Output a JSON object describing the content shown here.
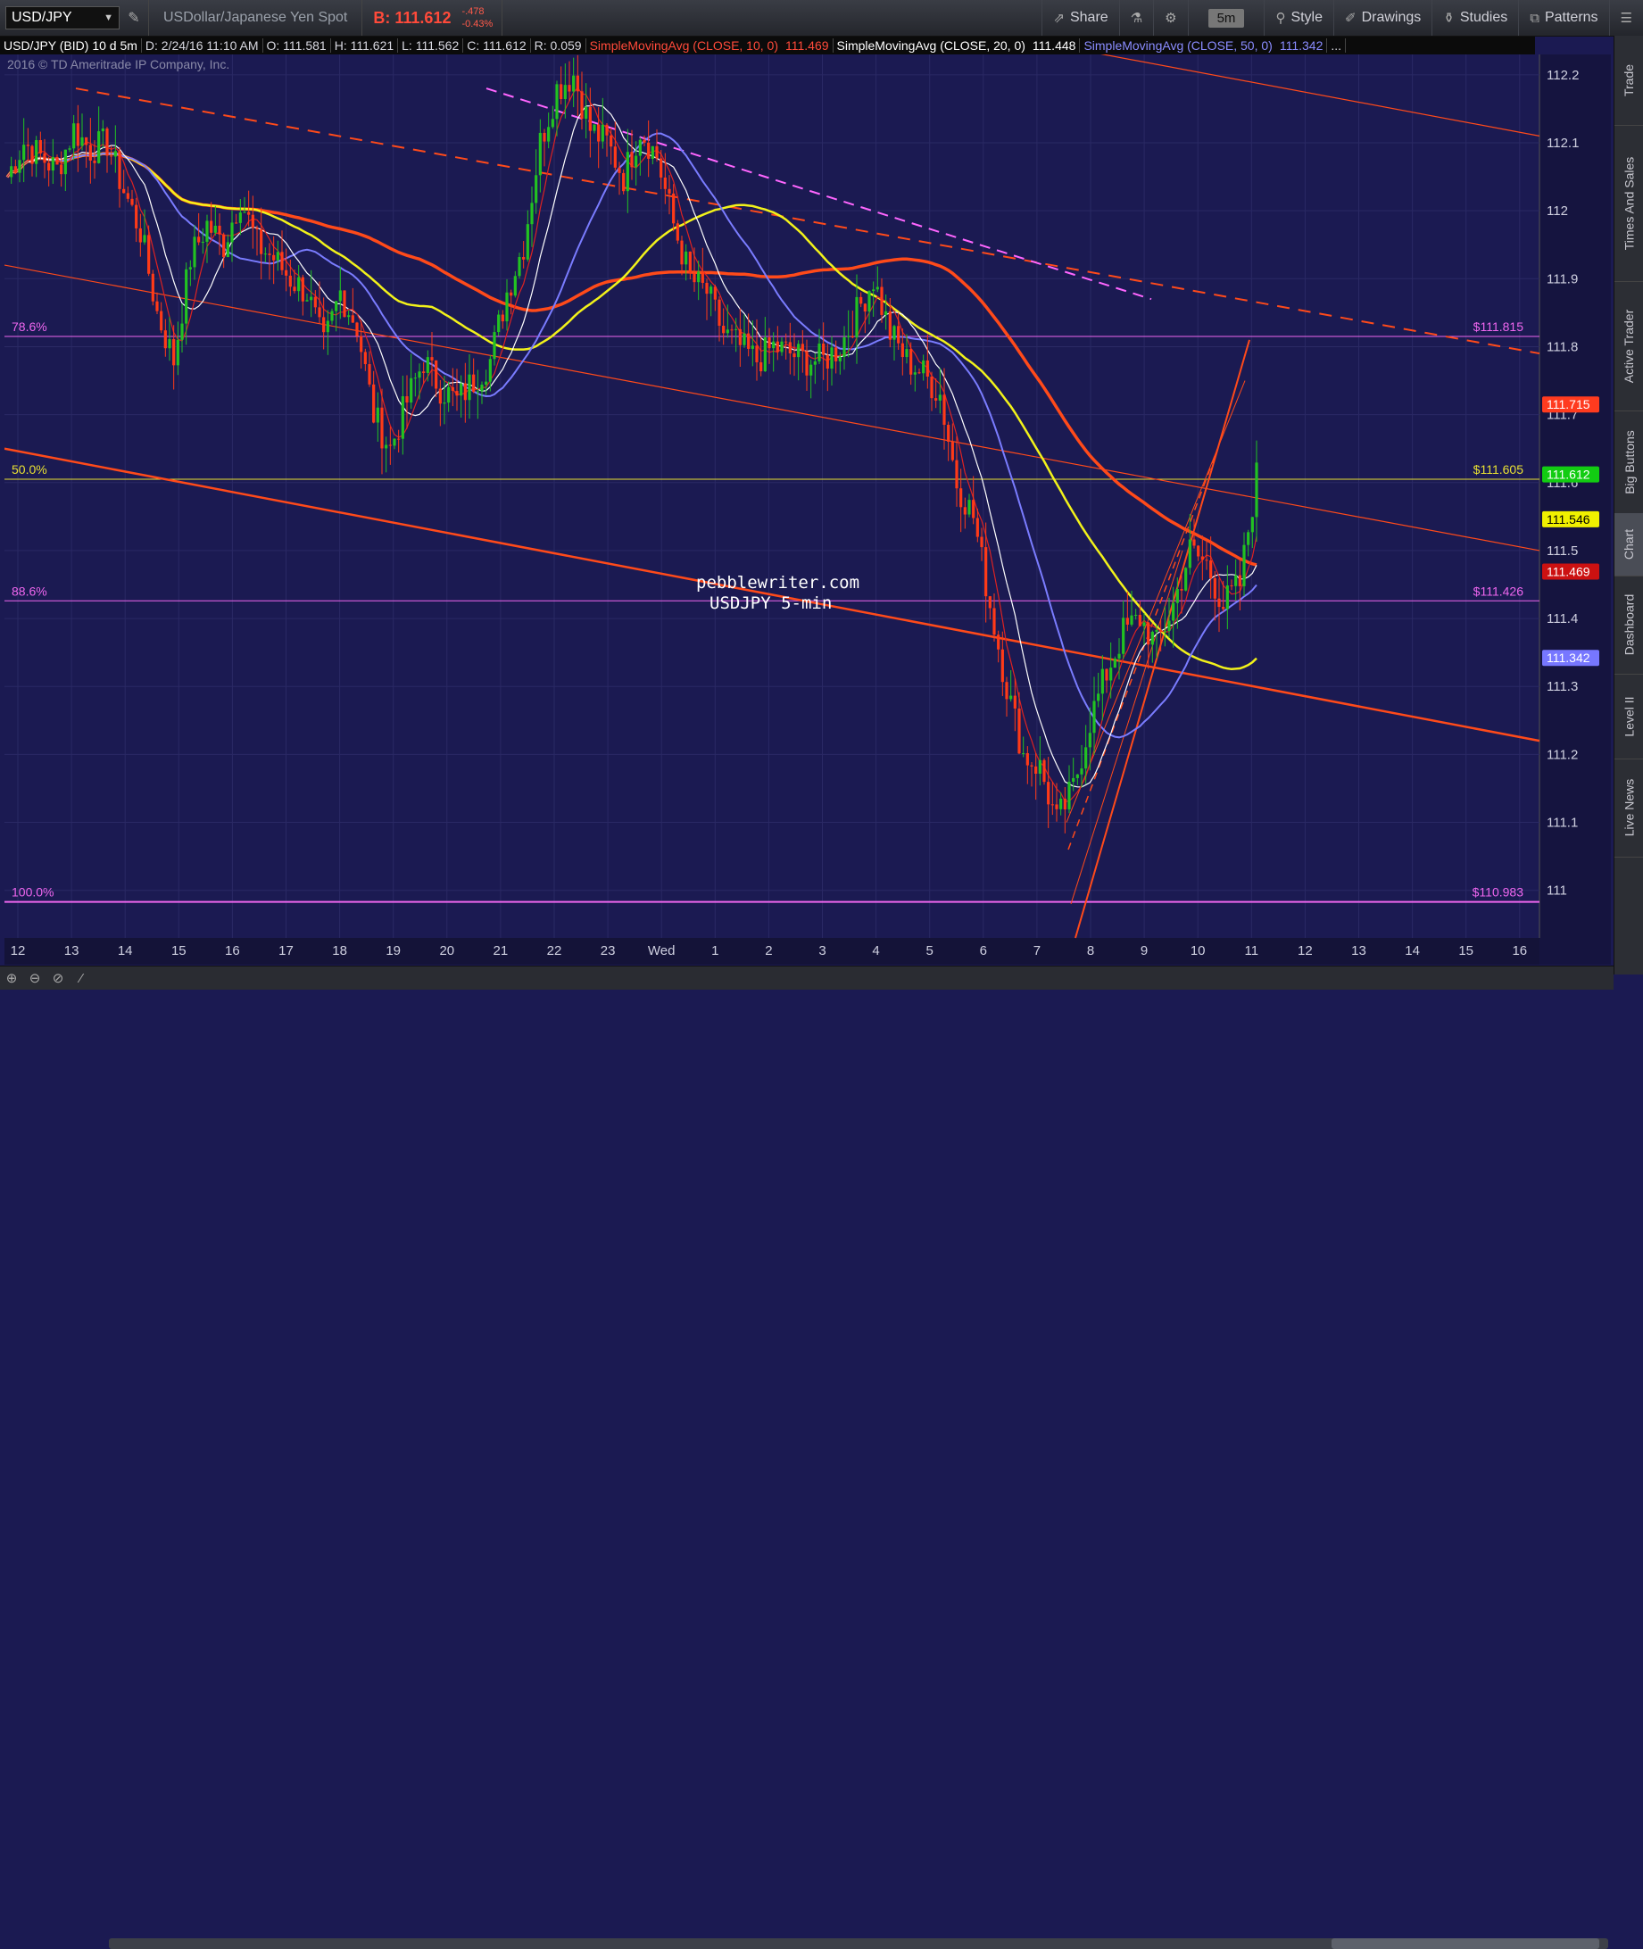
{
  "toolbar": {
    "symbol": "USD/JPY",
    "description": "USDollar/Japanese Yen Spot",
    "bid": "B: 111.612",
    "change": "-.478",
    "change_pct": "-0.43%",
    "share": "Share",
    "timeframe": "5m",
    "style": "Style",
    "drawings": "Drawings",
    "studies": "Studies",
    "patterns": "Patterns"
  },
  "status": {
    "symbol": "USD/JPY (BID) 10 d 5m",
    "date": "D: 2/24/16 11:10 AM",
    "open": "O: 111.581",
    "high": "H: 111.621",
    "low": "L: 111.562",
    "close": "C: 111.612",
    "range": "R: 0.059",
    "sma10": "SimpleMovingAvg (CLOSE, 10, 0)",
    "sma10_val": "111.469",
    "sma20": "SimpleMovingAvg (CLOSE, 20, 0)",
    "sma20_val": "111.448",
    "sma50": "SimpleMovingAvg (CLOSE, 50, 0)",
    "sma50_val": "111.342",
    "more": "..."
  },
  "sidebar": [
    "Trade",
    "Times And Sales",
    "Active Trader",
    "Big Buttons",
    "Chart",
    "Dashboard",
    "Level II",
    "Live News"
  ],
  "chart_data": {
    "type": "candlestick",
    "copyright": "2016 © TD Ameritrade IP Company, Inc.",
    "watermark": [
      "pebblewriter.com",
      "USDJPY 5-min"
    ],
    "ylim": [
      110.93,
      112.23
    ],
    "y_ticks": [
      111,
      111.1,
      111.2,
      111.3,
      111.4,
      111.5,
      111.6,
      111.7,
      111.8,
      111.9,
      112,
      112.1,
      112.2
    ],
    "x_labels": [
      "12",
      "13",
      "14",
      "15",
      "16",
      "17",
      "18",
      "19",
      "20",
      "21",
      "22",
      "23",
      "Wed",
      "1",
      "2",
      "3",
      "4",
      "5",
      "6",
      "7",
      "8",
      "9",
      "10",
      "11",
      "12",
      "13",
      "14",
      "15",
      "16"
    ],
    "fib_levels": [
      {
        "label": "78.6%",
        "value": 111.815,
        "price": "$111.815",
        "color": "#ee66ee"
      },
      {
        "label": "50.0%",
        "value": 111.605,
        "price": "$111.605",
        "color": "#e8e033"
      },
      {
        "label": "88.6%",
        "value": 111.426,
        "price": "$111.426",
        "color": "#ee66ee"
      },
      {
        "label": "100.0%",
        "value": 110.983,
        "price": "$110.983",
        "color": "#ee66ee"
      }
    ],
    "price_tags": [
      {
        "value": 111.715,
        "text": "111.715",
        "bg": "#ff3b1f",
        "fg": "#ffffff"
      },
      {
        "value": 111.612,
        "text": "111.612",
        "bg": "#12cc12",
        "fg": "#ffffff"
      },
      {
        "value": 111.546,
        "text": "111.546",
        "bg": "#f0f000",
        "fg": "#000000"
      },
      {
        "value": 111.469,
        "text": "111.469",
        "bg": "#cc1111",
        "fg": "#ffffff"
      },
      {
        "value": 111.342,
        "text": "111.342",
        "bg": "#7777ff",
        "fg": "#ffffff"
      }
    ],
    "colors": {
      "background": "#1b1a52",
      "up": "#22c222",
      "down": "#ff3a18",
      "sma10": "#dd2222",
      "sma20": "#ffffff",
      "sma50": "#7a7cff",
      "sma_yellow": "#f2f21a",
      "sma_orange": "#ff4a1a",
      "trend": "#ff4a1a",
      "magenta": "#ff66ff"
    },
    "ohlc_key": [
      [
        0,
        112.05
      ],
      [
        4,
        112.1
      ],
      [
        8,
        112.08
      ],
      [
        12,
        112.06
      ],
      [
        16,
        112.12
      ],
      [
        20,
        112.09
      ],
      [
        24,
        112.1
      ],
      [
        28,
        112.03
      ],
      [
        32,
        111.97
      ],
      [
        36,
        111.85
      ],
      [
        40,
        111.78
      ],
      [
        44,
        111.93
      ],
      [
        48,
        111.98
      ],
      [
        52,
        111.95
      ],
      [
        56,
        112.02
      ],
      [
        60,
        111.95
      ],
      [
        64,
        111.93
      ],
      [
        68,
        111.9
      ],
      [
        72,
        111.88
      ],
      [
        76,
        111.8
      ],
      [
        80,
        111.88
      ],
      [
        84,
        111.83
      ],
      [
        88,
        111.7
      ],
      [
        92,
        111.65
      ],
      [
        96,
        111.72
      ],
      [
        100,
        111.78
      ],
      [
        104,
        111.74
      ],
      [
        108,
        111.72
      ],
      [
        112,
        111.75
      ],
      [
        116,
        111.78
      ],
      [
        120,
        111.88
      ],
      [
        124,
        111.95
      ],
      [
        128,
        112.1
      ],
      [
        132,
        112.18
      ],
      [
        136,
        112.2
      ],
      [
        140,
        112.12
      ],
      [
        144,
        112.1
      ],
      [
        148,
        112.05
      ],
      [
        152,
        112.12
      ],
      [
        156,
        112.08
      ],
      [
        160,
        111.98
      ],
      [
        164,
        111.9
      ],
      [
        168,
        111.88
      ],
      [
        172,
        111.82
      ],
      [
        176,
        111.8
      ],
      [
        180,
        111.78
      ],
      [
        184,
        111.8
      ],
      [
        188,
        111.79
      ],
      [
        192,
        111.78
      ],
      [
        196,
        111.78
      ],
      [
        200,
        111.8
      ],
      [
        204,
        111.85
      ],
      [
        208,
        111.9
      ],
      [
        212,
        111.82
      ],
      [
        216,
        111.78
      ],
      [
        220,
        111.76
      ],
      [
        224,
        111.73
      ],
      [
        228,
        111.6
      ],
      [
        232,
        111.55
      ],
      [
        236,
        111.42
      ],
      [
        240,
        111.3
      ],
      [
        244,
        111.2
      ],
      [
        248,
        111.18
      ],
      [
        252,
        111.1
      ],
      [
        256,
        111.15
      ],
      [
        260,
        111.25
      ],
      [
        264,
        111.32
      ],
      [
        268,
        111.38
      ],
      [
        272,
        111.4
      ],
      [
        276,
        111.36
      ],
      [
        280,
        111.42
      ],
      [
        284,
        111.5
      ],
      [
        288,
        111.48
      ],
      [
        292,
        111.42
      ],
      [
        296,
        111.45
      ],
      [
        300,
        111.61
      ]
    ]
  }
}
